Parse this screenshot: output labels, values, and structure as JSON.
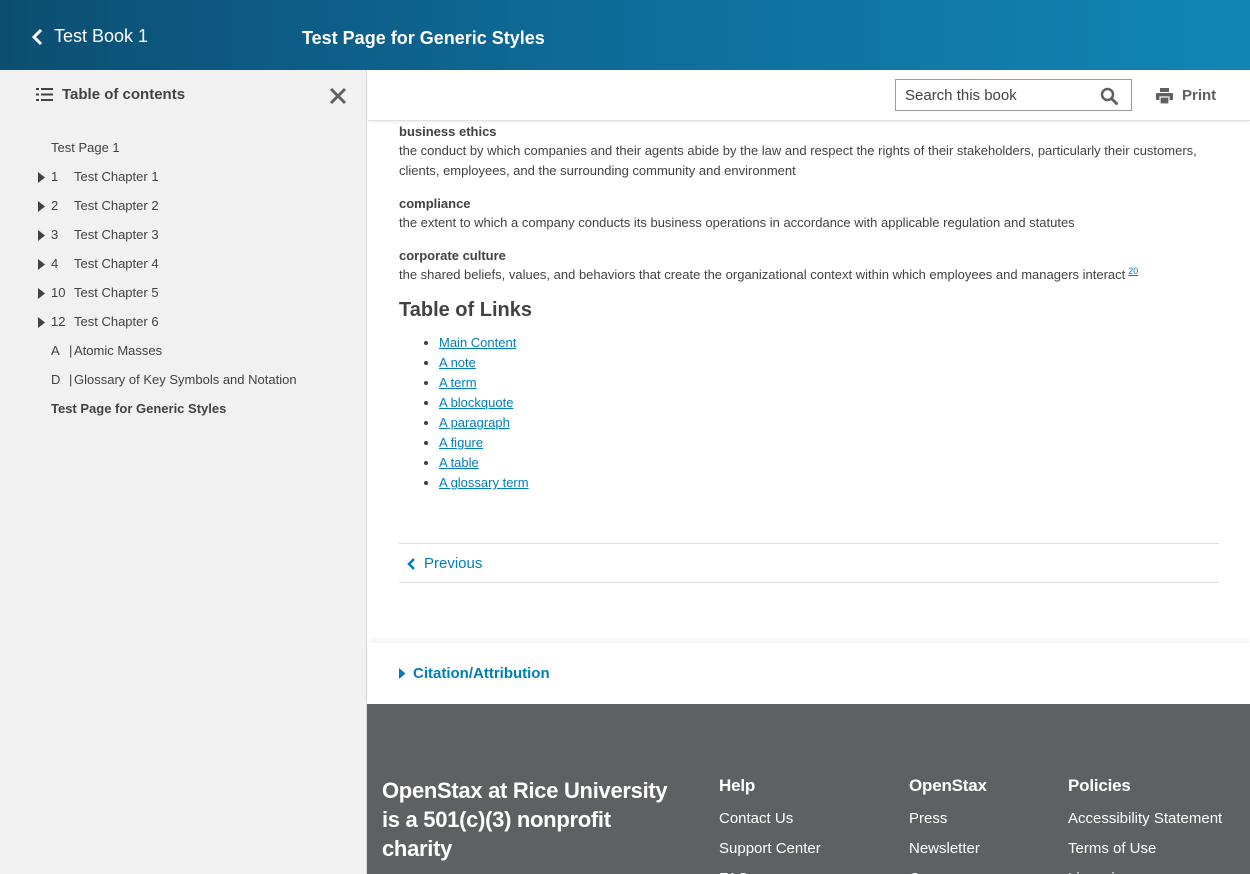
{
  "header": {
    "back_label": "Test Book 1",
    "page_title": "Test Page for Generic Styles",
    "colors": {
      "gradient_start": "#0c4e72",
      "gradient_end": "#1186b6"
    }
  },
  "sidebar": {
    "heading": "Table of contents",
    "items": [
      {
        "type": "plain",
        "label": "Test Page 1"
      },
      {
        "type": "chapter",
        "num": "1",
        "label": "Test Chapter 1"
      },
      {
        "type": "chapter",
        "num": "2",
        "label": "Test Chapter 2"
      },
      {
        "type": "chapter",
        "num": "3",
        "label": "Test Chapter 3"
      },
      {
        "type": "chapter",
        "num": "4",
        "label": "Test Chapter 4"
      },
      {
        "type": "chapter",
        "num": "10",
        "label": "Test Chapter 5"
      },
      {
        "type": "chapter",
        "num": "12",
        "label": "Test Chapter 6"
      },
      {
        "type": "appendix",
        "num": "A",
        "label": "Atomic Masses"
      },
      {
        "type": "appendix",
        "num": "D",
        "label": "Glossary of Key Symbols and Notation"
      },
      {
        "type": "current",
        "label": "Test Page for Generic Styles"
      }
    ]
  },
  "toolbar": {
    "search_placeholder": "Search this book",
    "print_label": "Print"
  },
  "glossary": [
    {
      "term": "business ethics",
      "definition": "the conduct by which companies and their agents abide by the law and respect the rights of their stakeholders, particularly their customers, clients, employees, and the surrounding community and environment"
    },
    {
      "term": "compliance",
      "definition": "the extent to which a company conducts its business operations in accordance with applicable regulation and statutes"
    },
    {
      "term": "corporate culture",
      "definition": "the shared beliefs, values, and behaviors that create the organizational context within which employees and managers interact",
      "footnote": "20"
    }
  ],
  "links_section": {
    "heading": "Table of Links",
    "items": [
      "Main Content",
      "A note",
      "A term",
      "A blockquote",
      "A paragraph",
      "A figure",
      "A table",
      "A glossary term"
    ]
  },
  "nav": {
    "previous_label": "Previous"
  },
  "citation": {
    "label": "Citation/Attribution"
  },
  "footer": {
    "charity": "OpenStax at Rice University is a 501(c)(3) nonprofit charity",
    "help": {
      "heading": "Help",
      "links": [
        "Contact Us",
        "Support Center",
        "FAQ"
      ]
    },
    "openstax": {
      "heading": "OpenStax",
      "links": [
        "Press",
        "Newsletter",
        "Careers"
      ]
    },
    "policies": {
      "heading": "Policies",
      "links": [
        "Accessibility Statement",
        "Terms of Use",
        "Licensing"
      ]
    },
    "background": "#5e6062"
  },
  "link_color": "#027eb5"
}
